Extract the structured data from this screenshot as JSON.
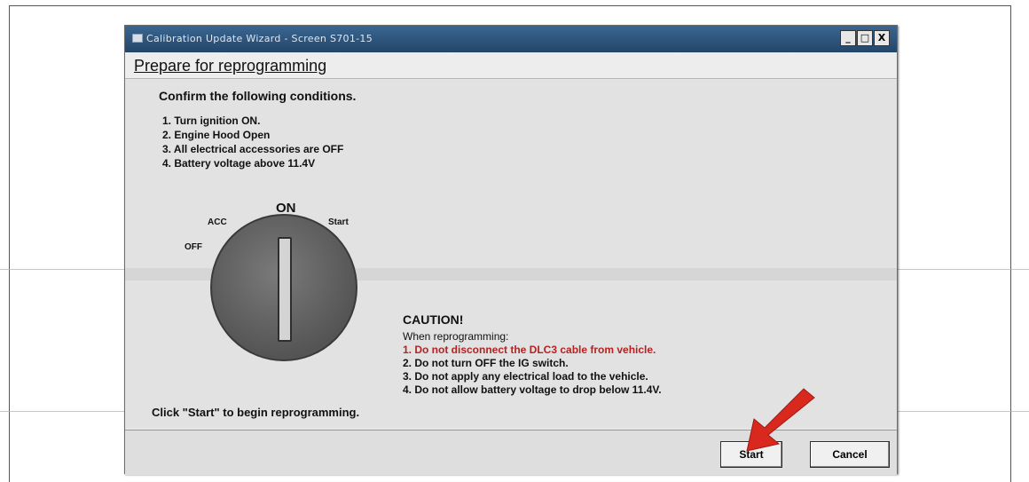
{
  "window": {
    "title": "Calibration Update Wizard - Screen S701-15",
    "controls": {
      "minimize": "_",
      "maximize": "□",
      "close": "X"
    }
  },
  "header": {
    "title": "Prepare for reprogramming"
  },
  "conditions": {
    "heading": "Confirm the following conditions.",
    "items": [
      "1. Turn ignition ON.",
      "2. Engine Hood Open",
      "3. All electrical accessories are OFF",
      "4. Battery voltage above 11.4V"
    ]
  },
  "ignition": {
    "on_label": "ON",
    "acc_label": "ACC",
    "start_label": "Start",
    "off_label": "OFF"
  },
  "caution": {
    "title": "CAUTION!",
    "intro": "When reprogramming:",
    "items": [
      "1. Do not disconnect the DLC3 cable from vehicle.",
      "2. Do not turn OFF the IG switch.",
      "3. Do not apply any electrical load to the vehicle.",
      "4. Do not allow battery voltage to drop below 11.4V."
    ],
    "highlight_color": "#b52222"
  },
  "instruction": "Click \"Start\" to begin reprogramming.",
  "buttons": {
    "start": "Start",
    "cancel": "Cancel"
  },
  "colors": {
    "titlebar": "#2f5780",
    "arrow": "#d9281e"
  }
}
